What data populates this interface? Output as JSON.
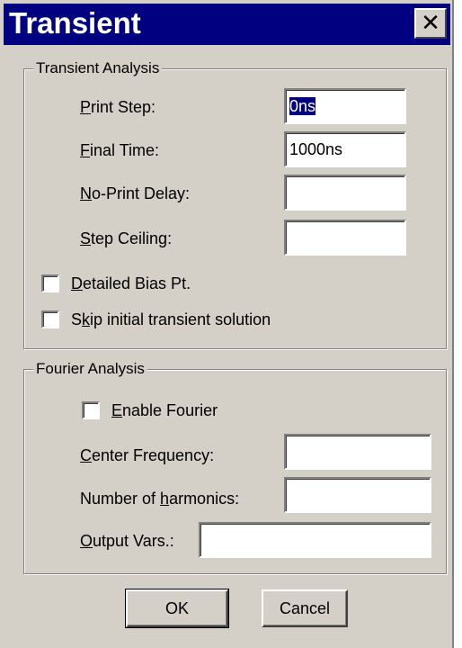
{
  "window": {
    "title": "Transient",
    "close_glyph": "✕"
  },
  "transient_analysis": {
    "legend": "Transient Analysis",
    "print_step": {
      "label_key": "P",
      "label_rest": "rint Step:",
      "value": "0ns",
      "selected": true
    },
    "final_time": {
      "label_key": "F",
      "label_rest": "inal Time:",
      "value": "1000ns"
    },
    "no_print_delay": {
      "label_key": "N",
      "label_rest": "o-Print Delay:",
      "value": ""
    },
    "step_ceiling": {
      "label_key": "S",
      "label_rest": "tep Ceiling:",
      "value": ""
    },
    "detailed_bias": {
      "label_key": "D",
      "label_rest": "etailed Bias Pt.",
      "checked": false
    },
    "skip_initial": {
      "label_pre": "S",
      "label_key": "k",
      "label_rest": "ip initial transient solution",
      "checked": false
    }
  },
  "fourier_analysis": {
    "legend": "Fourier Analysis",
    "enable_fourier": {
      "label_key": "E",
      "label_rest": "nable Fourier",
      "checked": false
    },
    "center_frequency": {
      "label_key": "C",
      "label_rest": "enter Frequency:",
      "value": ""
    },
    "num_harmonics": {
      "label_pre": "Number of ",
      "label_key": "h",
      "label_rest": "armonics:",
      "value": ""
    },
    "output_vars": {
      "label_key": "O",
      "label_rest": "utput Vars.:",
      "value": ""
    }
  },
  "buttons": {
    "ok": "OK",
    "cancel": "Cancel"
  }
}
